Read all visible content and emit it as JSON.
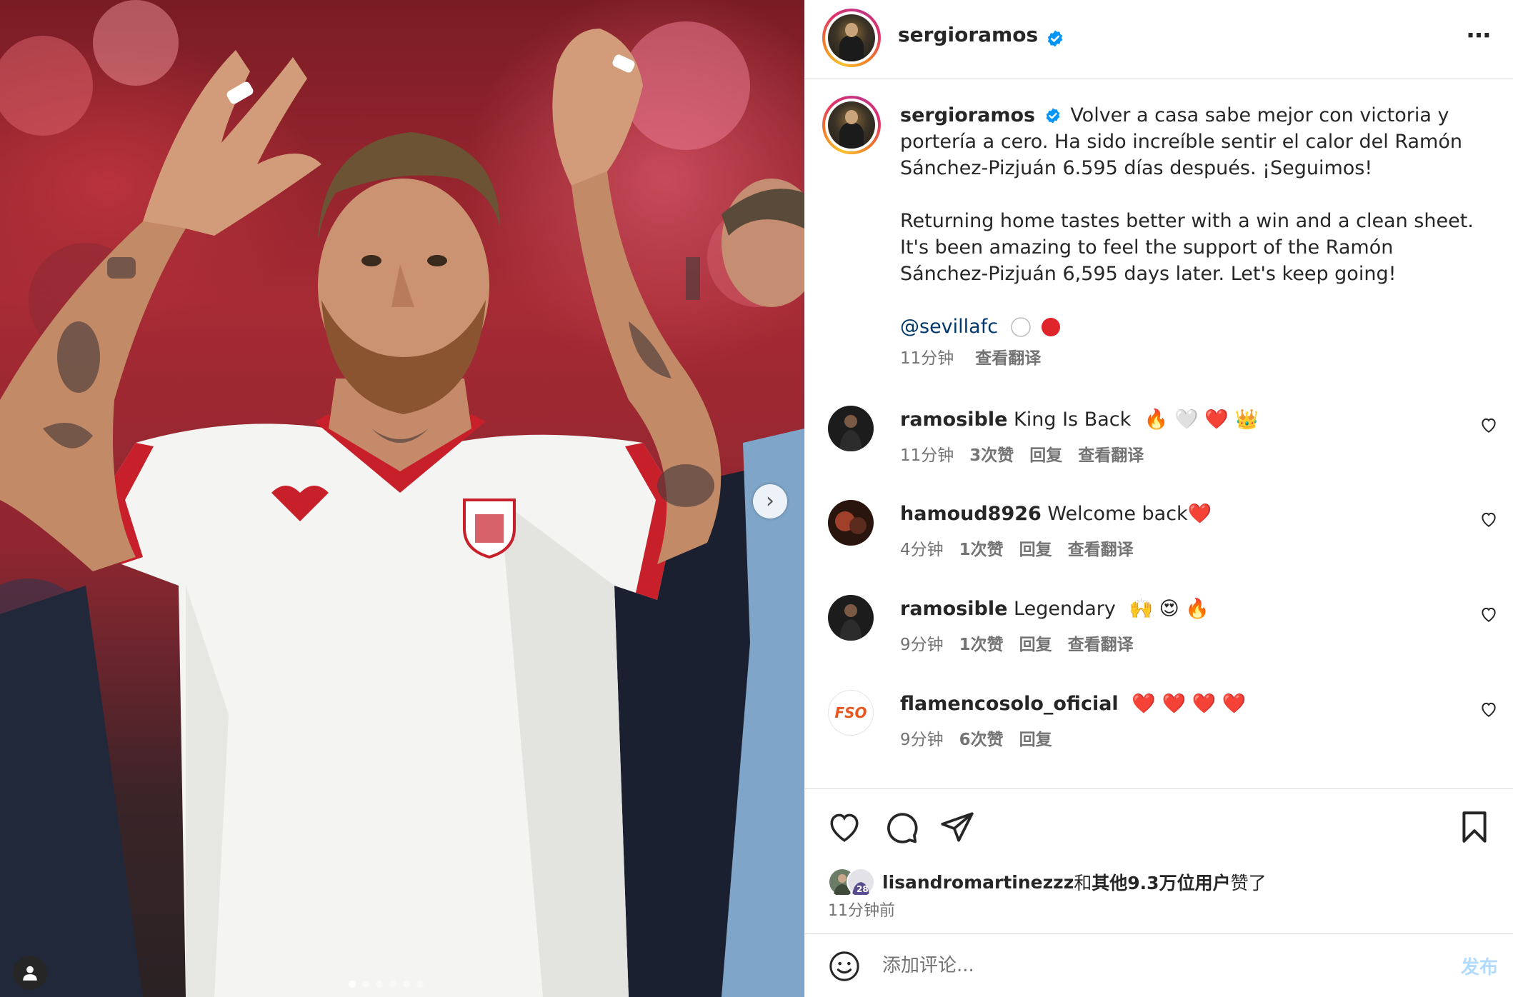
{
  "post": {
    "username": "sergioramos",
    "verified": true,
    "more_icon": "⋯",
    "image_alt": "Sergio Ramos in Sevilla white kit applauding the crowd",
    "carousel": {
      "count": 6,
      "active": 0
    }
  },
  "caption": {
    "username": "sergioramos",
    "line_es": "Volver a casa sabe mejor con victoria y portería a cero. Ha sido increíble sentir el calor del Ramón Sánchez-Pizjuán 6.595 días después. ¡Seguimos!",
    "line_en": "Returning home tastes better with a win and a clean sheet. It's been amazing to feel the support of the Ramón Sánchez-Pizjuán 6,595 days later. Let's keep going!",
    "mention": "@sevillafc",
    "time": "11分钟",
    "translate": "查看翻译"
  },
  "comments": [
    {
      "username": "ramosible",
      "text": "King Is Back",
      "emojis": "🔥 🤍 ❤️ 👑",
      "time": "11分钟",
      "likes": "3次赞",
      "reply": "回复",
      "translate": "查看翻译"
    },
    {
      "username": "hamoud8926",
      "text": "Welcome back",
      "emojis": "❤️",
      "time": "4分钟",
      "likes": "1次赞",
      "reply": "回复",
      "translate": "查看翻译"
    },
    {
      "username": "ramosible",
      "text": "Legendary",
      "emojis": "🙌 😍 🔥",
      "time": "9分钟",
      "likes": "1次赞",
      "reply": "回复",
      "translate": "查看翻译"
    },
    {
      "username": "flamencosolo_oficial",
      "text": "",
      "emojis": "❤️ ❤️ ❤️ ❤️",
      "time": "9分钟",
      "likes": "6次赞",
      "reply": "回复",
      "translate": ""
    }
  ],
  "avatars": {
    "flamenco_logo": "FSO"
  },
  "likes": {
    "user": "lisandromartinezzz",
    "and": "和",
    "others": "其他9.3万位用户",
    "suffix": "赞了",
    "time": "11分钟前"
  },
  "add_comment": {
    "emoji_icon": "smile-icon",
    "placeholder": "添加评论...",
    "post_label": "发布"
  },
  "colors": {
    "verified": "#0095f6",
    "heart_red": "#ed4956",
    "post_btn_disabled": "#b3dbff"
  }
}
